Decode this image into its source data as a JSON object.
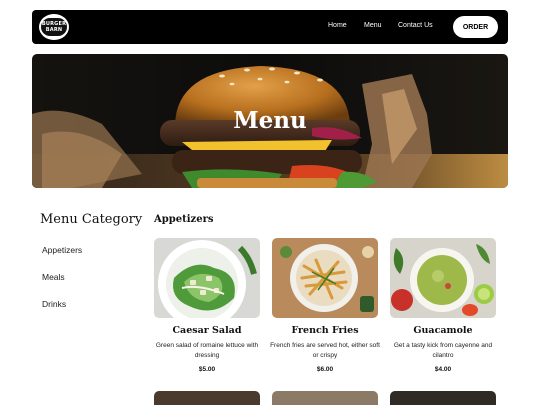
{
  "nav": {
    "logo_text": "BURGER BARN",
    "links": [
      "Home",
      "Menu",
      "Contact Us"
    ],
    "order_label": "ORDER"
  },
  "hero": {
    "title": "Menu"
  },
  "sidebar": {
    "title": "Menu Category",
    "items": [
      "Appetizers",
      "Meals",
      "Drinks"
    ]
  },
  "section": {
    "title": "Appetizers",
    "items": [
      {
        "name": "Caesar Salad",
        "description": "Green salad of romaine lettuce with dressing",
        "price": "$5.00"
      },
      {
        "name": "French Fries",
        "description": "French fries are served hot, either soft or crispy",
        "price": "$6.00"
      },
      {
        "name": "Guacamole",
        "description": "Get a tasty kick from cayenne and cilantro",
        "price": "$4.00"
      }
    ]
  },
  "colors": {
    "nav_bg": "#000000",
    "accent": "#ffffff"
  }
}
